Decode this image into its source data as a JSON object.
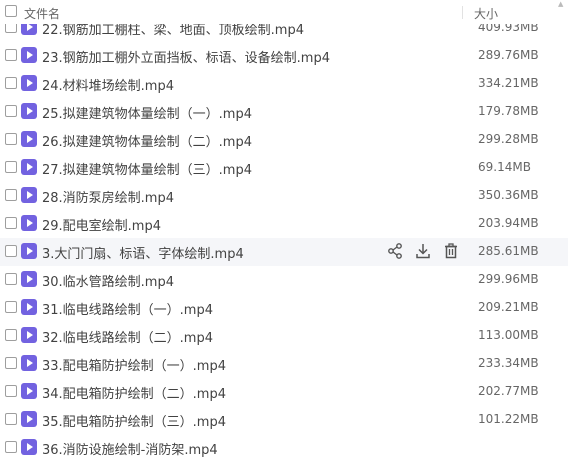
{
  "header": {
    "name_label": "文件名",
    "size_label": "大小"
  },
  "files": [
    {
      "name": "22.钢筋加工棚柱、梁、地面、顶板绘制.mp4",
      "size": "409.93MB"
    },
    {
      "name": "23.钢筋加工棚外立面挡板、标语、设备绘制.mp4",
      "size": "289.76MB"
    },
    {
      "name": "24.材料堆场绘制.mp4",
      "size": "334.21MB"
    },
    {
      "name": "25.拟建建筑物体量绘制（一）.mp4",
      "size": "179.78MB"
    },
    {
      "name": "26.拟建建筑物体量绘制（二）.mp4",
      "size": "299.28MB"
    },
    {
      "name": "27.拟建建筑物体量绘制（三）.mp4",
      "size": "69.14MB"
    },
    {
      "name": "28.消防泵房绘制.mp4",
      "size": "350.36MB"
    },
    {
      "name": "29.配电室绘制.mp4",
      "size": "203.94MB"
    },
    {
      "name": "3.大门门扇、标语、字体绘制.mp4",
      "size": "285.61MB"
    },
    {
      "name": "30.临水管路绘制.mp4",
      "size": "299.96MB"
    },
    {
      "name": "31.临电线路绘制（一）.mp4",
      "size": "209.21MB"
    },
    {
      "name": "32.临电线路绘制（二）.mp4",
      "size": "113.00MB"
    },
    {
      "name": "33.配电箱防护绘制（一）.mp4",
      "size": "233.34MB"
    },
    {
      "name": "34.配电箱防护绘制（二）.mp4",
      "size": "202.77MB"
    },
    {
      "name": "35.配电箱防护绘制（三）.mp4",
      "size": "101.22MB"
    },
    {
      "name": "36.消防设施绘制-消防架.mp4",
      "size": ""
    }
  ],
  "hover_row_index": 8,
  "row_actions": [
    "share-icon",
    "download-icon",
    "delete-icon"
  ],
  "colors": {
    "file_icon": "#7262e0",
    "hover_bg": "#f5f6f9"
  }
}
